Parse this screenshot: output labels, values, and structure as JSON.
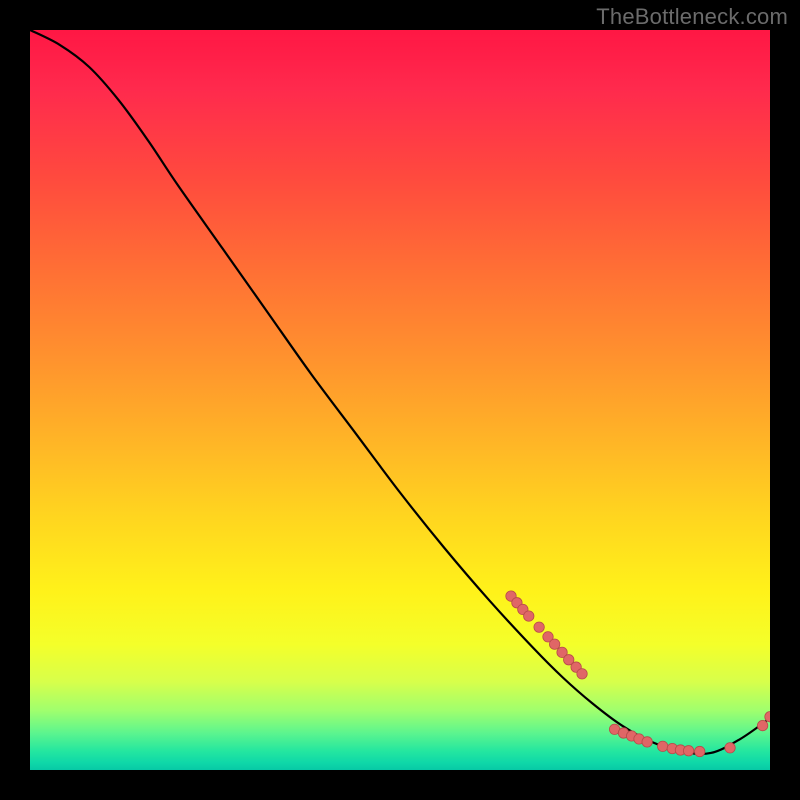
{
  "watermark": "TheBottleneck.com",
  "colors": {
    "page_bg": "#000000",
    "watermark": "#6b6b6b",
    "curve": "#000000",
    "dot_fill": "#e06666",
    "dot_stroke": "#b84a4a",
    "gradient_stops": [
      "#ff1744",
      "#ff2a4d",
      "#ff4a3e",
      "#ff6e35",
      "#ff912e",
      "#ffb327",
      "#ffd61f",
      "#fff21a",
      "#f4ff2a",
      "#d8ff4a",
      "#9fff6e",
      "#5cf58e",
      "#23e6a0",
      "#0fd8a8",
      "#07c9a6"
    ]
  },
  "chart_data": {
    "type": "line",
    "title": "",
    "xlabel": "",
    "ylabel": "",
    "xlim": [
      0,
      100
    ],
    "ylim": [
      0,
      100
    ],
    "grid": false,
    "legend": false,
    "series": [
      {
        "name": "bottleneck-curve",
        "x": [
          0,
          4,
          8,
          12,
          16,
          20,
          26,
          32,
          38,
          44,
          50,
          56,
          62,
          68,
          72,
          76,
          80,
          84,
          88,
          92,
          96,
          100
        ],
        "y": [
          100,
          98,
          95,
          90.5,
          85,
          79,
          70.5,
          62,
          53.5,
          45.5,
          37.5,
          30,
          23,
          16.5,
          12.5,
          9,
          6,
          3.8,
          2.5,
          2.3,
          4.2,
          7
        ]
      }
    ],
    "marker_clusters": [
      {
        "name": "upper-scatter",
        "points": [
          {
            "x": 65.0,
            "y": 23.5
          },
          {
            "x": 65.8,
            "y": 22.6
          },
          {
            "x": 66.6,
            "y": 21.7
          },
          {
            "x": 67.4,
            "y": 20.8
          },
          {
            "x": 68.8,
            "y": 19.3
          },
          {
            "x": 70.0,
            "y": 18.0
          },
          {
            "x": 70.9,
            "y": 17.0
          },
          {
            "x": 71.9,
            "y": 15.9
          },
          {
            "x": 72.8,
            "y": 14.9
          },
          {
            "x": 73.8,
            "y": 13.9
          },
          {
            "x": 74.6,
            "y": 13.0
          }
        ]
      },
      {
        "name": "floor-scatter",
        "points": [
          {
            "x": 79.0,
            "y": 5.5
          },
          {
            "x": 80.2,
            "y": 5.0
          },
          {
            "x": 81.3,
            "y": 4.6
          },
          {
            "x": 82.3,
            "y": 4.2
          },
          {
            "x": 83.4,
            "y": 3.8
          },
          {
            "x": 85.5,
            "y": 3.2
          },
          {
            "x": 86.8,
            "y": 2.9
          },
          {
            "x": 87.9,
            "y": 2.7
          },
          {
            "x": 89.0,
            "y": 2.6
          },
          {
            "x": 90.5,
            "y": 2.5
          },
          {
            "x": 94.6,
            "y": 3.0
          }
        ]
      },
      {
        "name": "tail-uptick",
        "points": [
          {
            "x": 99.0,
            "y": 6.0
          },
          {
            "x": 100.0,
            "y": 7.2
          }
        ]
      }
    ]
  }
}
